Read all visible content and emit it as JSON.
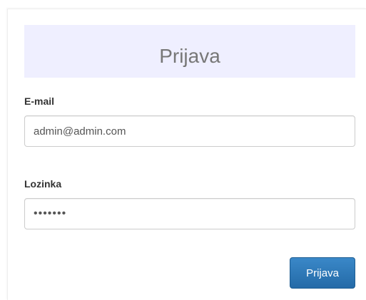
{
  "login_form": {
    "title": "Prijava",
    "email_label": "E-mail",
    "email_value": "admin@admin.com",
    "password_label": "Lozinka",
    "password_value": "•••••••",
    "submit_label": "Prijava"
  },
  "colors": {
    "header_background": "#efefff",
    "primary_button": "#2c78b8"
  }
}
